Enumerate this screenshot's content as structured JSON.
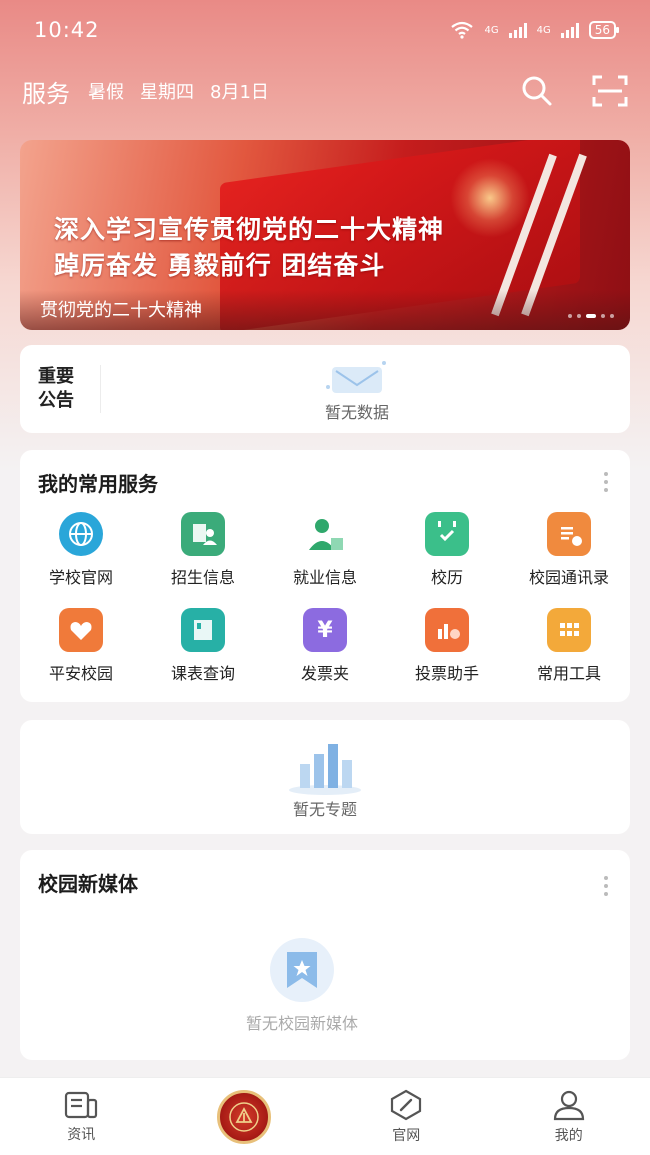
{
  "status_bar": {
    "time": "10:42",
    "network1": "4G",
    "network2": "4G",
    "battery": "56"
  },
  "header": {
    "title": "服务",
    "term": "暑假",
    "weekday": "星期四",
    "date": "8月1日"
  },
  "banner": {
    "line1": "深入学习宣传贯彻党的二十大精神",
    "line2": "踔厉奋发 勇毅前行 团结奋斗",
    "caption": "贯彻党的二十大精神"
  },
  "notice": {
    "label": "重要公告",
    "empty_text": "暂无数据"
  },
  "services": {
    "title": "我的常用服务",
    "items": [
      {
        "label": "学校官网",
        "icon": "globe-icon",
        "color": "#2aa6d9"
      },
      {
        "label": "招生信息",
        "icon": "admissions-icon",
        "color": "#3bab7a"
      },
      {
        "label": "就业信息",
        "icon": "employment-icon",
        "color": "#2fa86c"
      },
      {
        "label": "校历",
        "icon": "calendar-icon",
        "color": "#3bbf8a"
      },
      {
        "label": "校园通讯录",
        "icon": "contacts-icon",
        "color": "#f08a3e"
      },
      {
        "label": "平安校园",
        "icon": "safe-campus-icon",
        "color": "#f07a3a"
      },
      {
        "label": "课表查询",
        "icon": "timetable-icon",
        "color": "#27b0a6"
      },
      {
        "label": "发票夹",
        "icon": "invoice-icon",
        "color": "#8c6be0"
      },
      {
        "label": "投票助手",
        "icon": "vote-icon",
        "color": "#f0703a"
      },
      {
        "label": "常用工具",
        "icon": "tools-icon",
        "color": "#f3a93a"
      }
    ]
  },
  "topics": {
    "empty_text": "暂无专题"
  },
  "media": {
    "title": "校园新媒体",
    "empty_text": "暂无校园新媒体"
  },
  "tabbar": {
    "items": [
      {
        "label": "资讯",
        "icon": "news-icon"
      },
      {
        "label": "",
        "icon": "school-emblem-icon"
      },
      {
        "label": "官网",
        "icon": "compass-icon"
      },
      {
        "label": "我的",
        "icon": "user-icon"
      }
    ]
  }
}
